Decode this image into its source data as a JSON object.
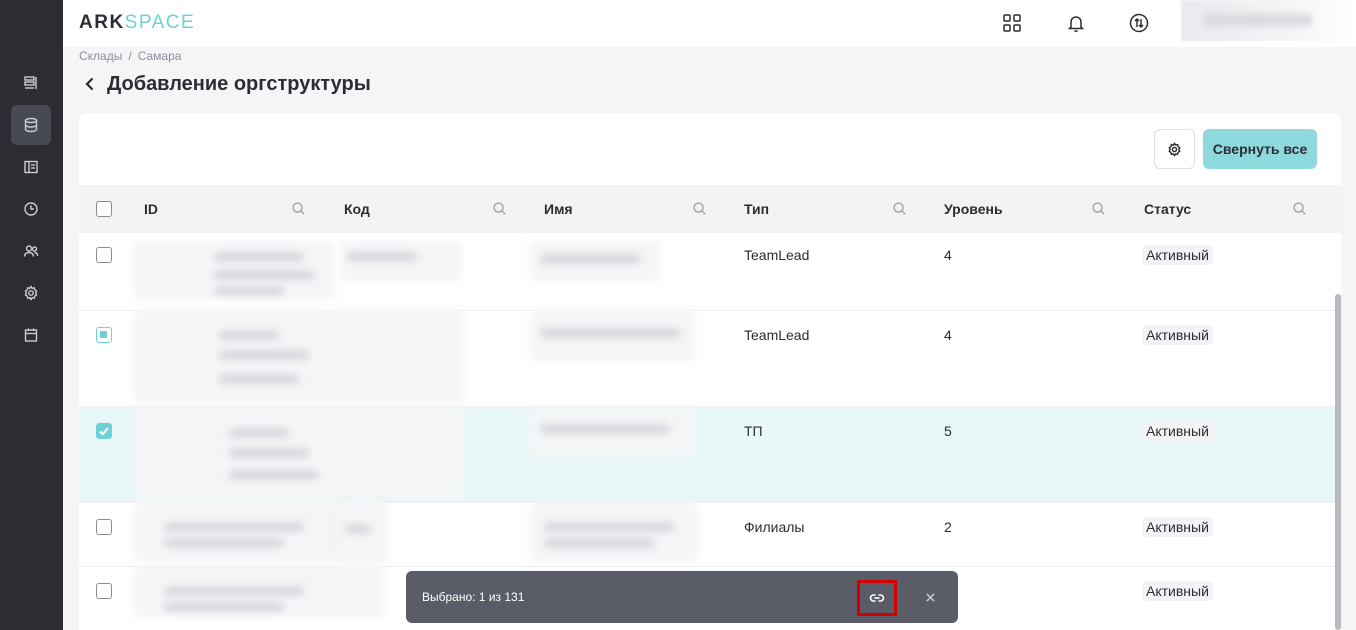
{
  "header": {
    "logo_part1": "ARK",
    "logo_part2": "SPACE",
    "icons": [
      "apps-grid-icon",
      "bell-icon",
      "switch-icon"
    ]
  },
  "sidebar": {
    "items": [
      {
        "icon": "list-icon",
        "active": false
      },
      {
        "icon": "database-icon",
        "active": true
      },
      {
        "icon": "layout-icon",
        "active": false
      },
      {
        "icon": "clock-icon",
        "active": false
      },
      {
        "icon": "users-icon",
        "active": false
      },
      {
        "icon": "gear-icon",
        "active": false
      },
      {
        "icon": "calendar-icon",
        "active": false
      }
    ]
  },
  "breadcrumb": {
    "items": [
      "Склады",
      "Самара"
    ],
    "separator": "/"
  },
  "page": {
    "title": "Добавление оргструктуры"
  },
  "toolbar": {
    "collapse_all_label": "Свернуть все"
  },
  "table": {
    "columns": [
      "ID",
      "Код",
      "Имя",
      "Тип",
      "Уровень",
      "Статус"
    ],
    "rows": [
      {
        "checked": "none",
        "type": "TeamLead",
        "level": "4",
        "status": "Активный"
      },
      {
        "checked": "partial",
        "type": "TeamLead",
        "level": "4",
        "status": "Активный"
      },
      {
        "checked": "checked",
        "type": "ТП",
        "level": "5",
        "status": "Активный"
      },
      {
        "checked": "none",
        "type": "Филиалы",
        "level": "2",
        "status": "Активный"
      },
      {
        "checked": "none",
        "type": "",
        "level": "",
        "status": "Активный"
      }
    ]
  },
  "selection_bar": {
    "text": "Выбрано: 1 из 131"
  },
  "colors": {
    "accent": "#6ed1d8",
    "sidebar_bg": "#2b2d33",
    "selected_row_bg": "#e8f7f8",
    "highlight_border": "#d40000"
  }
}
